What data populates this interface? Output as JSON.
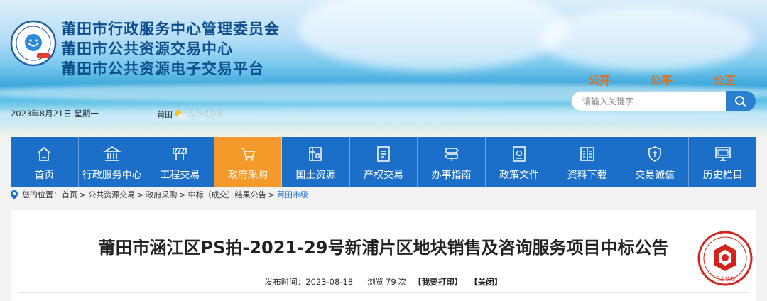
{
  "header": {
    "titles": [
      "莆田市行政服务中心管理委员会",
      "莆田市公共资源交易中心",
      "莆田市公共资源电子交易平台"
    ],
    "logo_text": "莆田市行政服务中心",
    "slogans": [
      "公开",
      "公平",
      "公正"
    ],
    "search_placeholder": "请输入关键字",
    "date": "2023年8月21日 星期一",
    "weather_city": "莆田",
    "weather_temp": "26~33℃",
    "icons": [
      "logo-icon",
      "weather-sun-icon",
      "search-icon"
    ]
  },
  "nav": {
    "active_index": 3,
    "active_color": "#f39a2b",
    "bar_color": "#1b6fc8",
    "items": [
      {
        "label": "首页",
        "icon": "home-icon"
      },
      {
        "label": "行政服务中心",
        "icon": "building-icon"
      },
      {
        "label": "工程交易",
        "icon": "engineering-icon"
      },
      {
        "label": "政府采购",
        "icon": "cart-icon"
      },
      {
        "label": "国土资源",
        "icon": "land-icon"
      },
      {
        "label": "产权交易",
        "icon": "property-icon"
      },
      {
        "label": "办事指南",
        "icon": "signpost-icon"
      },
      {
        "label": "政策文件",
        "icon": "policy-doc-icon"
      },
      {
        "label": "资料下载",
        "icon": "download-book-icon"
      },
      {
        "label": "交易诚信",
        "icon": "shield-icon"
      },
      {
        "label": "历史栏目",
        "icon": "monitor-icon"
      }
    ]
  },
  "breadcrumb": {
    "prefix": "您的位置：",
    "items": [
      "首页",
      "公共资源交易",
      "政府采购",
      "中标（成交）结果公告",
      "莆田市级"
    ],
    "separator": ">"
  },
  "article": {
    "title": "莆田市涵江区PS拍-2021-29号新浦片区地块销售及咨询服务项目中标公告",
    "publish_label": "发布时间：",
    "publish_date": "2023-08-18",
    "views_label": "浏览",
    "views_count": "79",
    "views_unit": "次",
    "print_label": "【我要打印】",
    "close_label": "【关闭】",
    "stamp_text": "马上就办"
  }
}
